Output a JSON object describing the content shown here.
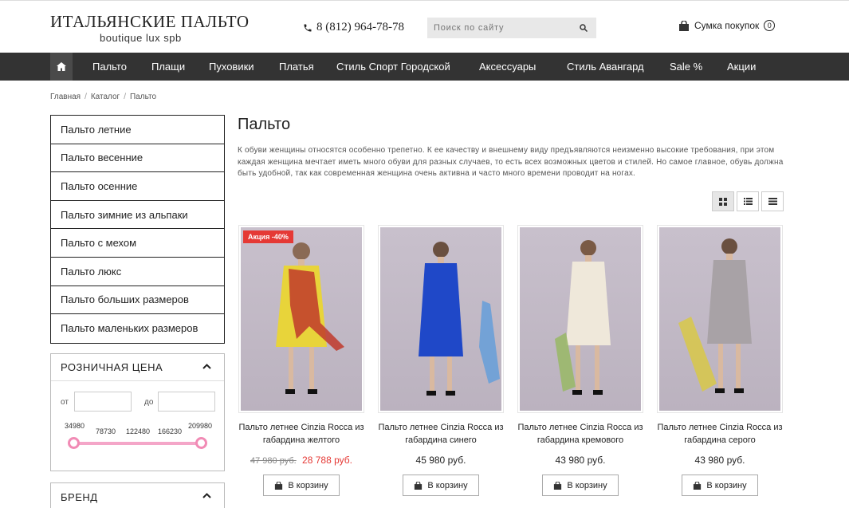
{
  "header": {
    "logo_title": "ИТАЛЬЯНСКИЕ ПАЛЬТО",
    "logo_subtitle": "boutique lux spb",
    "phone": "8 (812) 964-78-78",
    "search_placeholder": "Поиск по сайту",
    "cart_label": "Сумка покупок",
    "cart_count": "0"
  },
  "nav": {
    "items": [
      "Пальто",
      "Плащи",
      "Пуховики",
      "Платья",
      "Стиль Спорт Городской",
      "Аксессуары",
      "Стиль Авангард",
      "Sale %",
      "Акции"
    ]
  },
  "breadcrumb": [
    "Главная",
    "Каталог",
    "Пальто"
  ],
  "sidebar": {
    "categories": [
      "Пальто летние",
      "Пальто весенние",
      "Пальто осенние",
      "Пальто зимние из альпаки",
      "Пальто с мехом",
      "Пальто люкс",
      "Пальто больших размеров",
      "Пальто маленьких размеров"
    ],
    "price_filter": {
      "title": "РОЗНИЧНАЯ ЦЕНА",
      "from_label": "от",
      "to_label": "до",
      "ticks": [
        "34980",
        "78730",
        "122480",
        "166230",
        "209980"
      ]
    },
    "brand_title": "БРЕНД"
  },
  "main": {
    "title": "Пальто",
    "description": "К обуви женщины относятся особенно трепетно. К ее качеству и внешнему виду предъявляются неизменно высокие требования, при этом каждая женщина мечтает иметь много обуви для разных случаев, то есть всех возможных цветов и стилей. Но самое главное, обувь должна быть удобной, так как современная женщина очень активна и часто много времени проводит на ногах.",
    "products": [
      {
        "name": "Пальто летнее Cinzia Rocca из габардина желтого",
        "old_price": "47 980 руб.",
        "price": "28 788 руб.",
        "badge": "Акция -40%",
        "coat_color": "#e8d43a",
        "scarf_color": "#c0392b",
        "button": "В корзину"
      },
      {
        "name": "Пальто летнее Cinzia Rocca из габардина синего",
        "old_price": "",
        "price": "45 980 руб.",
        "badge": "",
        "coat_color": "#1f48c8",
        "scarf_color": "#6aa0d8",
        "button": "В корзину"
      },
      {
        "name": "Пальто летнее Cinzia Rocca из габардина кремового",
        "old_price": "",
        "price": "43 980 руб.",
        "badge": "",
        "coat_color": "#efe8da",
        "scarf_color": "#9ab86a",
        "button": "В корзину"
      },
      {
        "name": "Пальто летнее Cinzia Rocca из габардина серого",
        "old_price": "",
        "price": "43 980 руб.",
        "badge": "",
        "coat_color": "#a8a2a6",
        "scarf_color": "#d8c848",
        "button": "В корзину"
      }
    ]
  }
}
